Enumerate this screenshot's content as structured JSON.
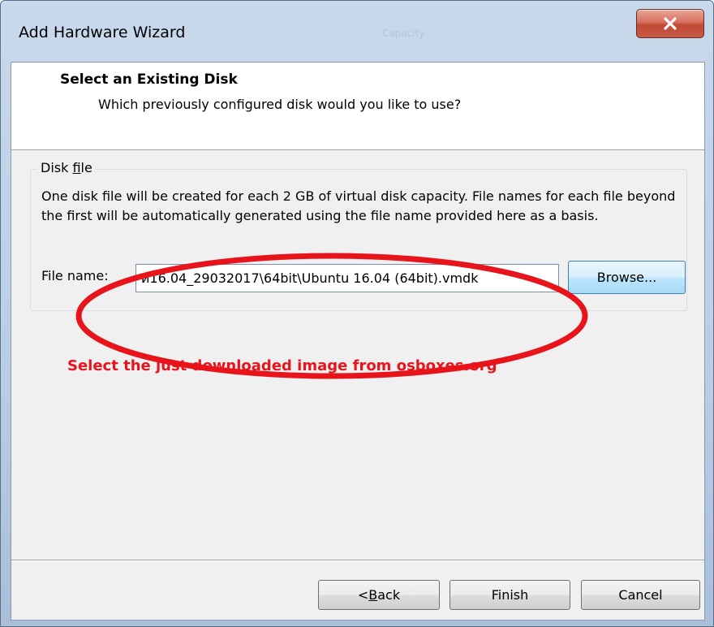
{
  "window": {
    "title": "Add Hardware Wizard",
    "background_ghost_text": "Capacity"
  },
  "header": {
    "title": "Select an Existing Disk",
    "subtitle": "Which previously configured disk would you like to use?"
  },
  "disk_file": {
    "group_label_prefix": "Disk ",
    "group_label_accel": "f",
    "group_label_suffix": "ile",
    "description": "One disk file will be created for each 2 GB of virtual disk capacity. File names for each file beyond the first will be automatically generated using the file name provided here as a basis.",
    "filename_label": "File name:",
    "filename_value": "и16.04_29032017\\64bit\\Ubuntu 16.04 (64bit).vmdk",
    "browse_label": "Browse..."
  },
  "annotation": {
    "text": "Select the just downloaded image from osboxes.org",
    "color": "#e8141b"
  },
  "footer": {
    "back_prefix": "< ",
    "back_accel": "B",
    "back_suffix": "ack",
    "finish_label": "Finish",
    "cancel_label": "Cancel"
  },
  "icons": {
    "close": "close-icon"
  }
}
